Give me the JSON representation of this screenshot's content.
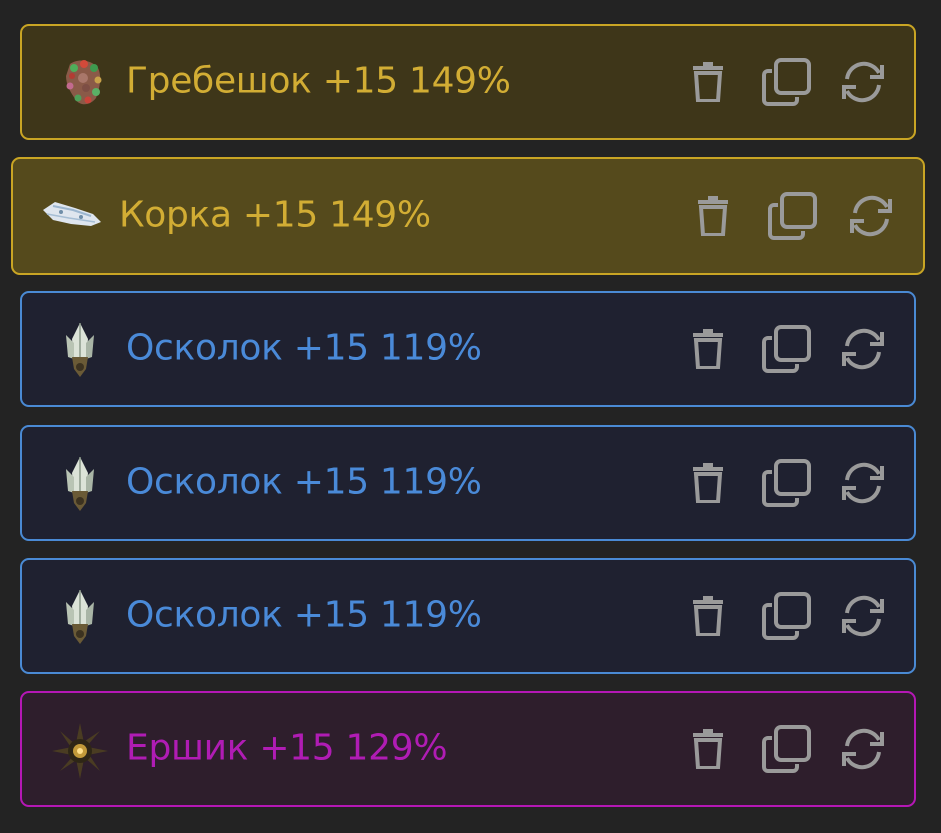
{
  "items": [
    {
      "name": "Гребешок",
      "enhance": "+15",
      "percent": "149%",
      "label": "Гребешок +15 149%",
      "color": "#d2ad34",
      "icon": "coral-comb-icon"
    },
    {
      "name": "Корка",
      "enhance": "+15",
      "percent": "149%",
      "label": "Корка +15 149%",
      "color": "#d2ad34",
      "icon": "crust-blade-icon"
    },
    {
      "name": "Осколок",
      "enhance": "+15",
      "percent": "119%",
      "label": "Осколок +15 119%",
      "color": "#4a8ad8",
      "icon": "crystal-shard-icon"
    },
    {
      "name": "Осколок",
      "enhance": "+15",
      "percent": "119%",
      "label": "Осколок +15 119%",
      "color": "#4a8ad8",
      "icon": "crystal-shard-icon"
    },
    {
      "name": "Осколок",
      "enhance": "+15",
      "percent": "119%",
      "label": "Осколок +15 119%",
      "color": "#4a8ad8",
      "icon": "crystal-shard-icon"
    },
    {
      "name": "Ершик",
      "enhance": "+15",
      "percent": "129%",
      "label": "Ершик +15 129%",
      "color": "#b01cb4",
      "icon": "spiky-urchin-icon"
    }
  ],
  "actions": {
    "delete_icon": "trash-icon",
    "copy_icon": "copy-icon",
    "replace_icon": "swap-icon"
  },
  "colors": {
    "background": "#232323",
    "gold_border": "#c9a524",
    "blue_border": "#4a8ad4",
    "purple_border": "#b517b5",
    "action_icon": "#9a9a9a"
  }
}
